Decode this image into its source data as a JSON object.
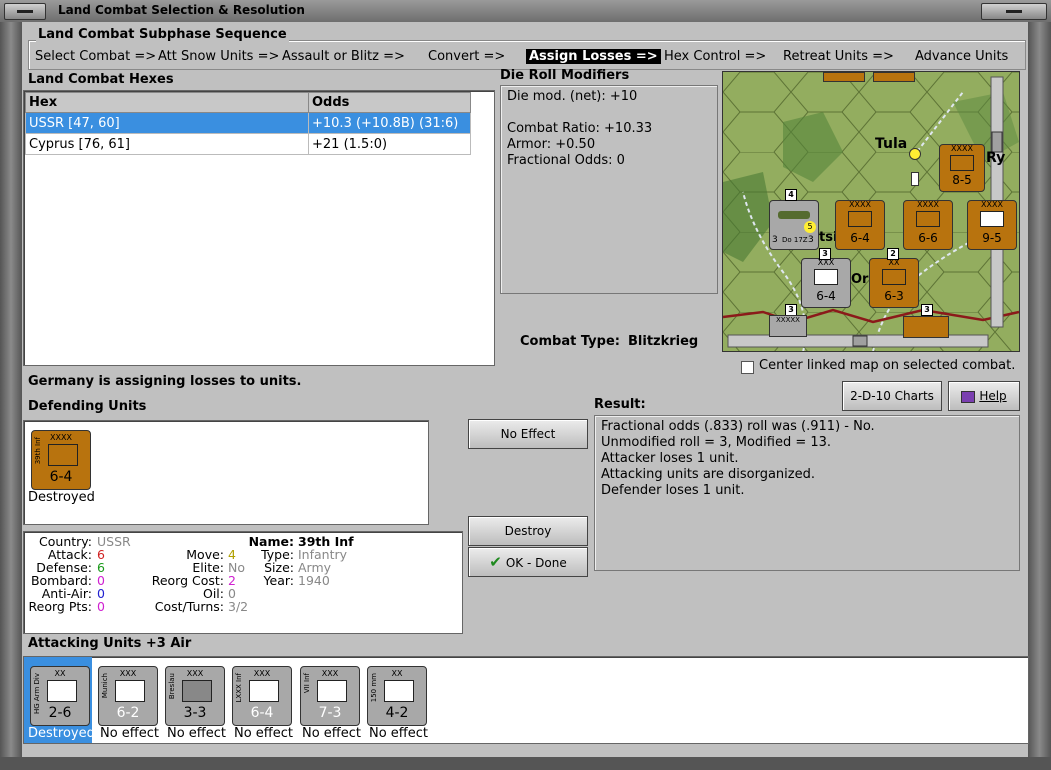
{
  "window": {
    "title": "Land Combat Selection & Resolution"
  },
  "subphase": {
    "title": "Land Combat Subphase Sequence",
    "items": [
      "Select Combat =>",
      "Att Snow Units =>",
      "Assault or Blitz =>",
      "Convert =>",
      "Assign Losses =>",
      "Hex Control =>",
      "Retreat Units =>",
      "Advance Units"
    ],
    "active_index": 4
  },
  "hexes": {
    "title": "Land Combat Hexes",
    "columns": [
      "Hex",
      "Odds"
    ],
    "rows": [
      {
        "hex": "USSR [47, 60]",
        "odds": "+10.3 (+10.8B) (31:6)",
        "selected": true
      },
      {
        "hex": "Cyprus [76, 61]",
        "odds": "+21 (1.5:0)",
        "selected": false
      }
    ]
  },
  "modifiers": {
    "title": "Die Roll Modifiers",
    "lines": [
      "Die mod. (net): +10",
      "",
      "Combat Ratio: +10.33",
      "Armor: +0.50",
      "Fractional Odds: 0"
    ]
  },
  "combat_type": {
    "label": "Combat Type:",
    "value": "Blitzkrieg"
  },
  "map": {
    "city_tula": "Tula",
    "city_ry": "Ry",
    "city_ore": "Ore",
    "city_tsi": "tsi",
    "units": [
      {
        "size": "XXXX",
        "strength": "8-5"
      },
      {
        "size": "XXXX",
        "strength": "6-4"
      },
      {
        "size": "XXXX",
        "strength": "6-6"
      },
      {
        "size": "XXXX",
        "strength": "9-5"
      },
      {
        "size": "XXX",
        "strength": "6-4"
      },
      {
        "size": "XX",
        "strength": "6-3"
      }
    ],
    "air_unit": {
      "top": "4",
      "left": "3",
      "name": "Do 17Z",
      "right": "3",
      "badge": "5"
    },
    "stack_badges": [
      "4",
      "3",
      "2",
      "3",
      "3"
    ],
    "top_size": "XXXXX"
  },
  "center_linked": {
    "label": "Center linked map on selected combat.",
    "checked": false
  },
  "status": "Germany is assigning losses to units.",
  "buttons": {
    "charts": "2-D-10 Charts",
    "help": "Help",
    "no_effect": "No Effect",
    "destroy": "Destroy",
    "done": "OK - Done"
  },
  "defending": {
    "title": "Defending Units",
    "units": [
      {
        "size": "XXXX",
        "vname": "39th Inf",
        "strength": "6-4",
        "status": "Destroyed",
        "color": "#b8730e"
      }
    ]
  },
  "result": {
    "title": "Result:",
    "lines": [
      "Fractional odds (.833) roll was (.911)  - No.",
      "Unmodified roll = 3, Modified = 13.",
      "Attacker loses 1 unit.",
      "Attacking units are disorganized.",
      "Defender loses 1 unit."
    ]
  },
  "unit_info": {
    "country_k": "Country:",
    "country_v": "USSR",
    "attack_k": "Attack:",
    "attack_v": "6",
    "defense_k": "Defense:",
    "defense_v": "6",
    "bombard_k": "Bombard:",
    "bombard_v": "0",
    "antiair_k": "Anti-Air:",
    "antiair_v": "0",
    "reorgpts_k": "Reorg Pts:",
    "reorgpts_v": "0",
    "move_k": "Move:",
    "move_v": "4",
    "elite_k": "Elite:",
    "elite_v": "No",
    "reorgcost_k": "Reorg Cost:",
    "reorgcost_v": "2",
    "oil_k": "Oil:",
    "oil_v": "0",
    "costturns_k": "Cost/Turns:",
    "costturns_v": "3/2",
    "name_k": "Name:",
    "name_v": "39th Inf",
    "type_k": "Type:",
    "type_v": "Infantry",
    "size_k": "Size:",
    "size_v": "Army",
    "year_k": "Year:",
    "year_v": "1940"
  },
  "attacking": {
    "title": "Attacking Units +3 Air",
    "units": [
      {
        "size": "XX",
        "vname": "HG Arm Div",
        "strength": "2-6",
        "status": "Destroyed",
        "selected": true
      },
      {
        "size": "XXX",
        "vname": "Munich",
        "strength": "6-2",
        "status": "No effect",
        "selected": false
      },
      {
        "size": "XXX",
        "vname": "Breslau",
        "strength": "3-3",
        "status": "No effect",
        "selected": false
      },
      {
        "size": "XXX",
        "vname": "LXXX Inf",
        "strength": "6-4",
        "status": "No effect",
        "selected": false
      },
      {
        "size": "XXX",
        "vname": "VII Inf",
        "strength": "7-3",
        "status": "No effect",
        "selected": false
      },
      {
        "size": "XX",
        "vname": "150 mm",
        "strength": "4-2",
        "status": "No effect",
        "selected": false
      }
    ]
  }
}
